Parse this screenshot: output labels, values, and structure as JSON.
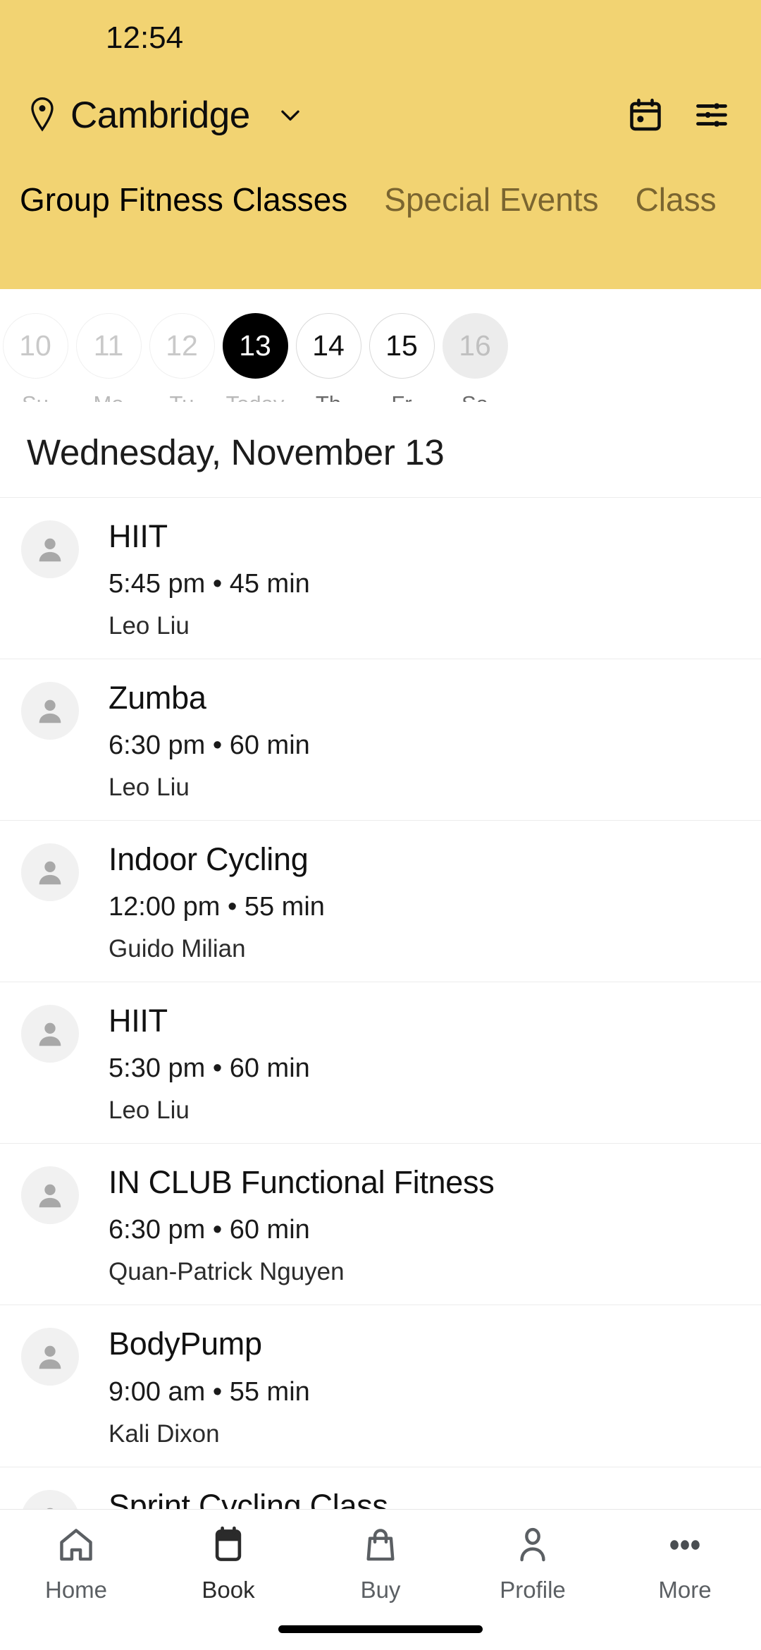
{
  "status_bar": {
    "time": "12:54"
  },
  "header": {
    "location": "Cambridge",
    "location_pin_icon": "location-pin-icon",
    "chevron_icon": "chevron-down-icon",
    "calendar_icon": "calendar-icon",
    "filter_icon": "filter-sliders-icon",
    "background_color": "#f2d372",
    "tabs": [
      {
        "label": "Group Fitness Classes",
        "active": true
      },
      {
        "label": "Special Events",
        "active": false
      },
      {
        "label": "Class",
        "active": false
      }
    ]
  },
  "date_strip": [
    {
      "day_number": "10",
      "weekday": "Su",
      "state": "past"
    },
    {
      "day_number": "11",
      "weekday": "Mo",
      "state": "past"
    },
    {
      "day_number": "12",
      "weekday": "Tu",
      "state": "past"
    },
    {
      "day_number": "13",
      "weekday": "Today",
      "state": "today"
    },
    {
      "day_number": "14",
      "weekday": "Th",
      "state": "future"
    },
    {
      "day_number": "15",
      "weekday": "Fr",
      "state": "future"
    },
    {
      "day_number": "16",
      "weekday": "Sa",
      "state": "filled"
    }
  ],
  "day_heading": "Wednesday, November 13",
  "classes": [
    {
      "name": "HIIT",
      "meta": "5:45 pm • 45 min",
      "instructor": "Leo Liu"
    },
    {
      "name": "Zumba",
      "meta": "6:30 pm • 60 min",
      "instructor": "Leo Liu"
    },
    {
      "name": "Indoor Cycling",
      "meta": "12:00 pm • 55 min",
      "instructor": "Guido Milian"
    },
    {
      "name": "HIIT",
      "meta": "5:30 pm • 60 min",
      "instructor": "Leo Liu"
    },
    {
      "name": "IN CLUB Functional Fitness",
      "meta": "6:30 pm • 60 min",
      "instructor": "Quan-Patrick Nguyen"
    },
    {
      "name": "BodyPump",
      "meta": "9:00 am • 55 min",
      "instructor": "Kali Dixon"
    },
    {
      "name": "Sprint Cycling Class",
      "meta": "",
      "instructor": ""
    }
  ],
  "bottom_nav": [
    {
      "label": "Home",
      "icon": "home-icon",
      "active": false
    },
    {
      "label": "Book",
      "icon": "calendar-icon",
      "active": true
    },
    {
      "label": "Buy",
      "icon": "bag-icon",
      "active": false
    },
    {
      "label": "Profile",
      "icon": "person-icon",
      "active": false
    },
    {
      "label": "More",
      "icon": "ellipsis-icon",
      "active": false
    }
  ]
}
